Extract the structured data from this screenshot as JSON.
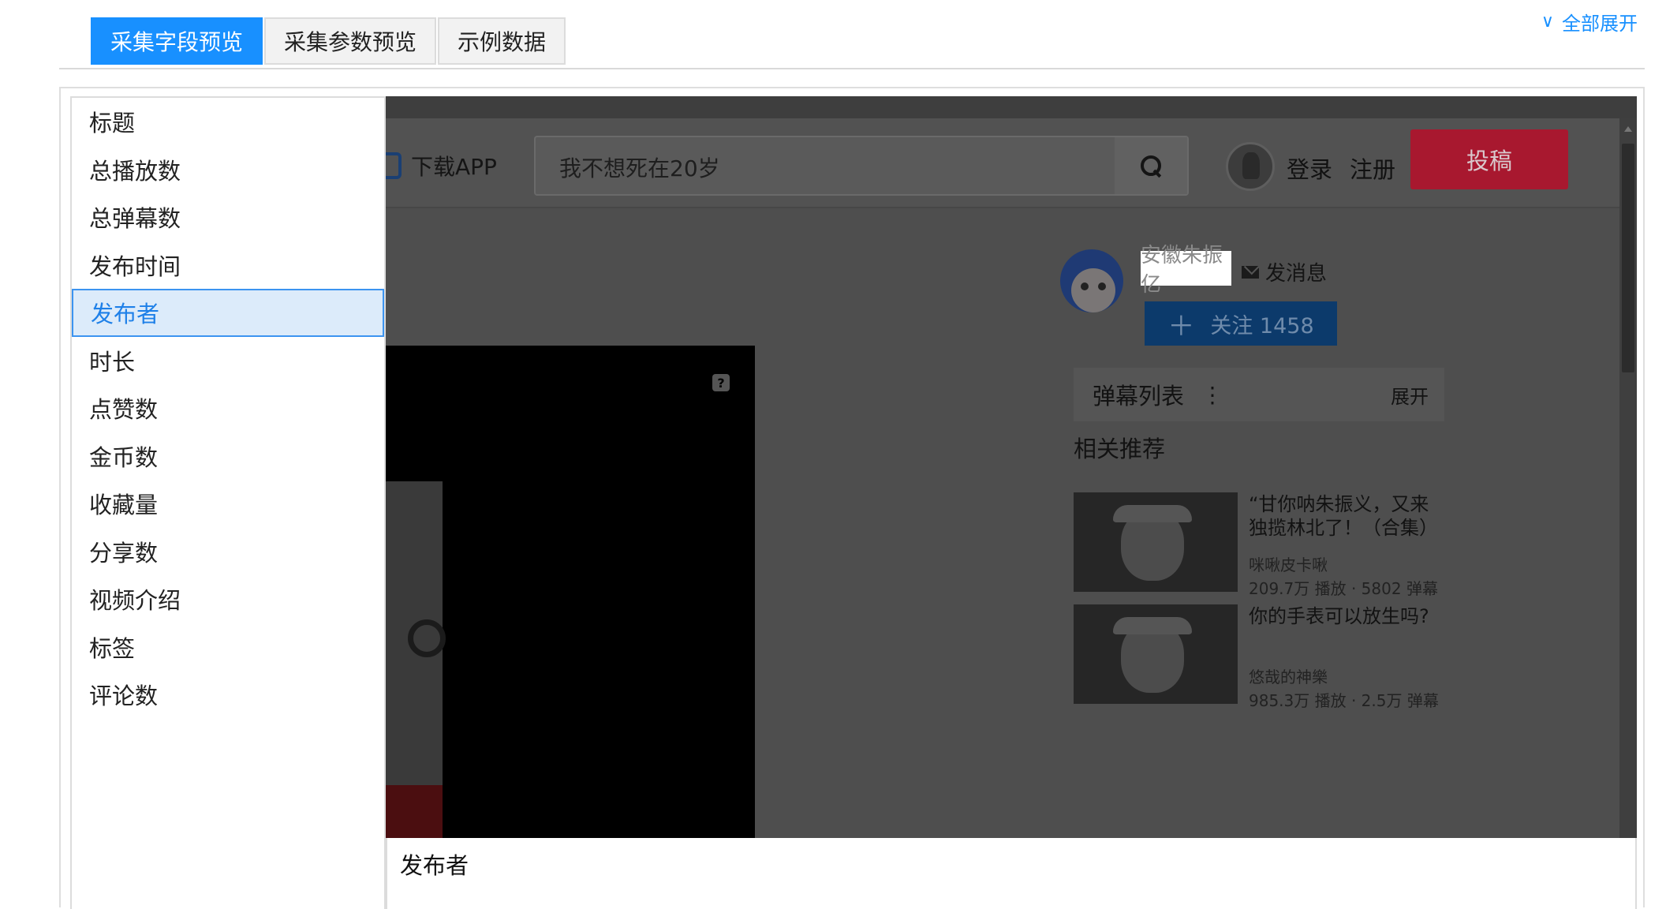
{
  "tabs": [
    {
      "label": "采集字段预览",
      "active": true
    },
    {
      "label": "采集参数预览",
      "active": false
    },
    {
      "label": "示例数据",
      "active": false
    }
  ],
  "expand_all": {
    "chevron": "∨",
    "label": "全部展开"
  },
  "field_list": {
    "items": [
      "标题",
      "总播放数",
      "总弹幕数",
      "发布时间",
      "发布者",
      "时长",
      "点赞数",
      "金币数",
      "收藏量",
      "分享数",
      "视频介绍",
      "标签",
      "评论数"
    ],
    "selected_index": 4
  },
  "preview": {
    "download_app": "下载APP",
    "search_text": "我不想死在20岁",
    "login": "登录",
    "register": "注册",
    "post": "投稿",
    "uploader_name": "安徽朱振亿",
    "send_message": "发消息",
    "follow_plus": "＋",
    "follow_label": "关注 1458",
    "help_glyph": "?",
    "danmaku_title": "弹幕列表",
    "danmaku_dots": "⋮",
    "danmaku_expand": "展开",
    "related_title": "相关推荐",
    "cards": [
      {
        "title": "“甘你呐朱振义，又来独揽林北了！（合集）",
        "author": "咪啾皮卡啾",
        "stats": "209.7万 播放 · 5802 弹幕"
      },
      {
        "title": "你的手表可以放生吗?",
        "author": "悠哉的神樂",
        "stats": "985.3万 播放 · 2.5万 弹幕"
      }
    ],
    "colors": {
      "accent": "#1890ff",
      "post_button": "#a8182f",
      "follow_button": "#0c3a6b"
    }
  },
  "selected_field_caption": "发布者"
}
